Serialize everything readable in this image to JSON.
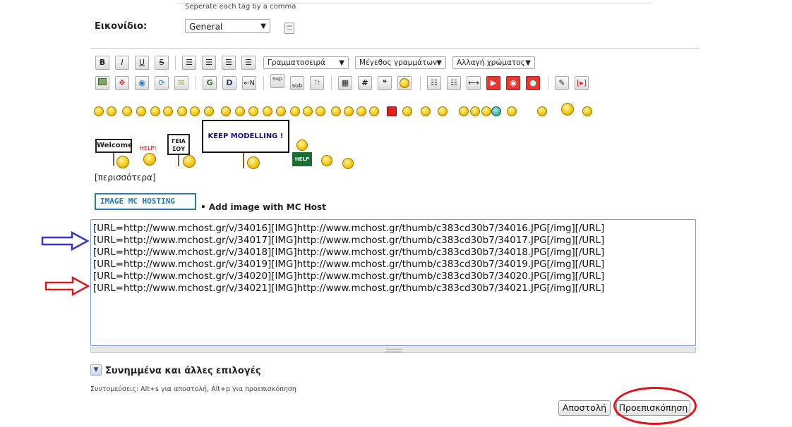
{
  "tags_hint": "Seperate each tag by a comma",
  "icon_field": {
    "label": "Εικονίδιο:",
    "selected": "General"
  },
  "toolbar": {
    "row1": [
      "B",
      "I",
      "U",
      "S"
    ],
    "font_select": "Γραμματοσειρά",
    "size_select": "Μέγεθος γραμμάτων",
    "color_select": "Αλλαγή χρώματος",
    "row2_text": {
      "g": "G",
      "d": "D",
      "sup": "sup",
      "sub": "sub",
      "tt": "Tt",
      "hash": "#"
    }
  },
  "signs": {
    "welcome": "Welcome",
    "help1": "HELP!",
    "geia": "ΓΕΙΑ ΣΟΥ",
    "keep": "KEEP MODELLING !",
    "help2": "HELP"
  },
  "more_link": "[περισσότερα]",
  "image_hosting": {
    "logo": "IMAGE  MC  HOSTING",
    "add": "• Add image with MC Host"
  },
  "editor_text": "[URL=http://www.mchost.gr/v/34016][IMG]http://www.mchost.gr/thumb/c383cd30b7/34016.JPG[/img][/URL]\n[URL=http://www.mchost.gr/v/34017][IMG]http://www.mchost.gr/thumb/c383cd30b7/34017.JPG[/img][/URL]\n[URL=http://www.mchost.gr/v/34018][IMG]http://www.mchost.gr/thumb/c383cd30b7/34018.JPG[/img][/URL]\n[URL=http://www.mchost.gr/v/34019][IMG]http://www.mchost.gr/thumb/c383cd30b7/34019.JPG[/img][/URL]\n[URL=http://www.mchost.gr/v/34020][IMG]http://www.mchost.gr/thumb/c383cd30b7/34020.JPG[/img][/URL]\n[URL=http://www.mchost.gr/v/34021][IMG]http://www.mchost.gr/thumb/c383cd30b7/34021.JPG[/img][/URL]",
  "attachments": {
    "label": "Συνημμένα και άλλες επιλογές"
  },
  "shortcuts": "Συντομεύσεις: Alt+s για αποστολή, Alt+p για προεπισκόπηση",
  "buttons": {
    "submit": "Αποστολή",
    "preview": "Προεπισκόπηση"
  },
  "colors": {
    "blue_arrow": "#3535c8",
    "red_arrow": "#d81c1c",
    "ellipse": "#e0141b",
    "editor_border": "#7a9cd3"
  }
}
